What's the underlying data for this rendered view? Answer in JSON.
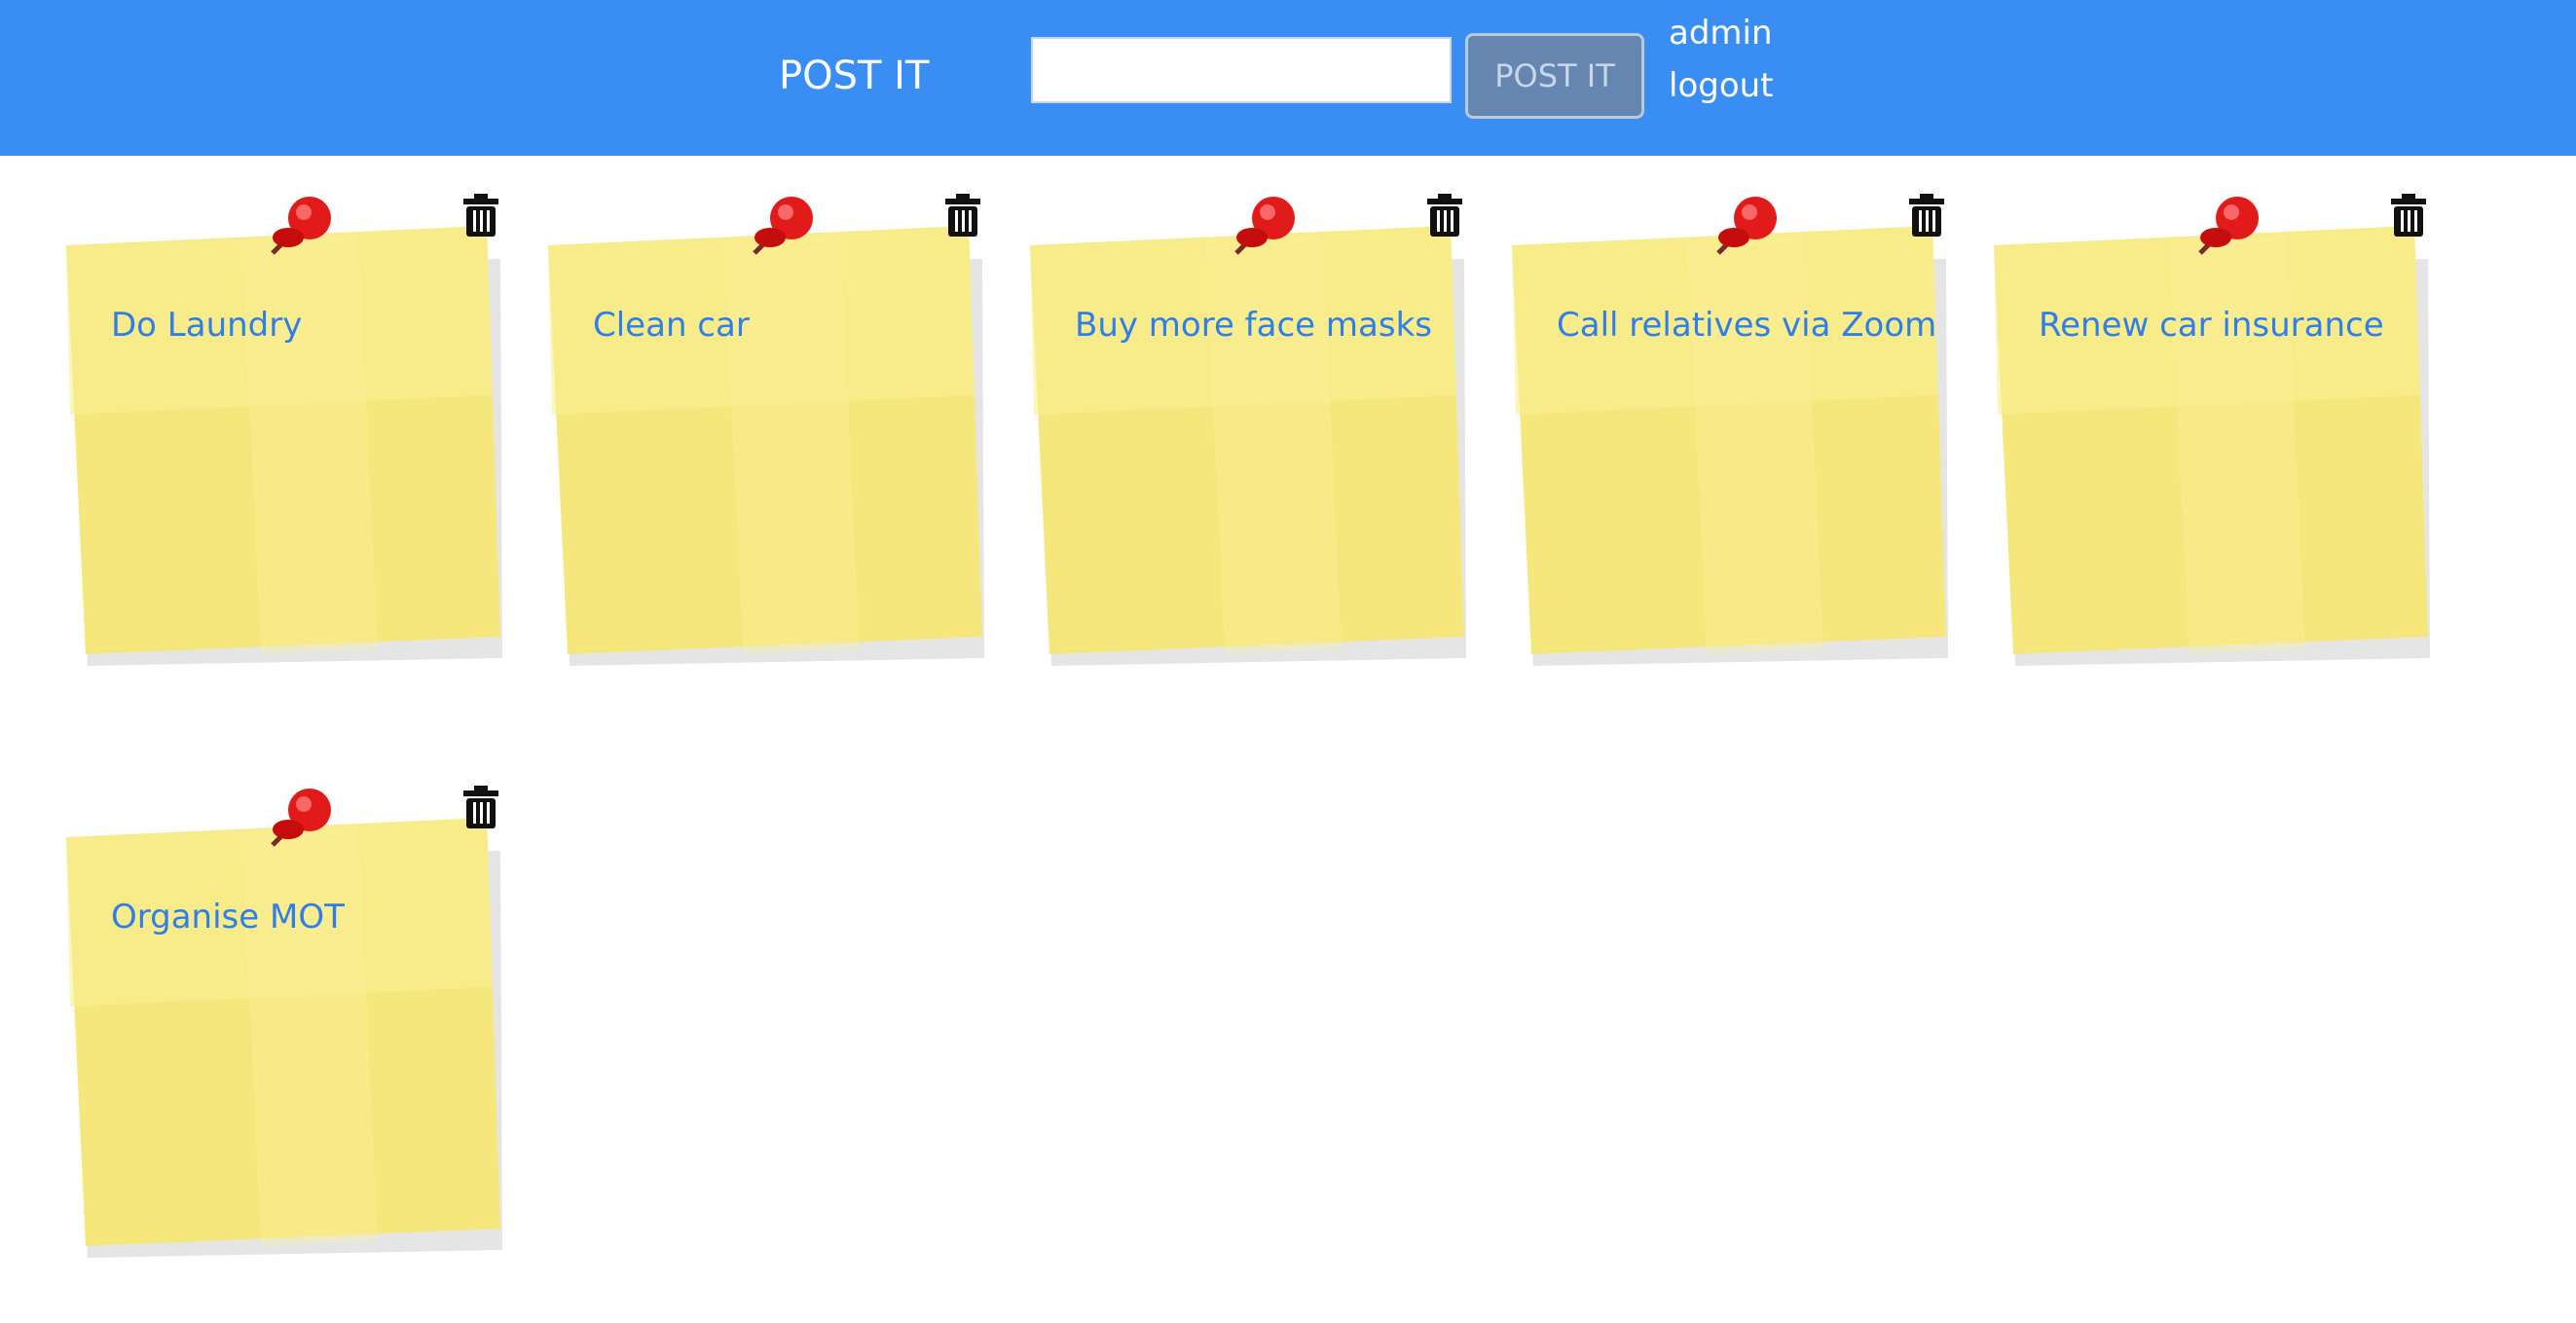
{
  "header": {
    "brand": "POST IT",
    "input_value": "",
    "button_label": "POST IT",
    "user": "admin",
    "logout": "logout",
    "background_color": "#3a8ef3"
  },
  "notes": [
    {
      "text": "Do Laundry"
    },
    {
      "text": "Clean car"
    },
    {
      "text": "Buy more face masks"
    },
    {
      "text": "Call relatives via Zoom"
    },
    {
      "text": "Renew car insurance"
    },
    {
      "text": "Organise MOT"
    }
  ],
  "icons": {
    "delete": "trash-icon",
    "pin": "pushpin-icon"
  },
  "colors": {
    "note_yellow": "#f6e77d",
    "note_text": "#2f7ee9",
    "pin_red": "#e11a1a"
  }
}
